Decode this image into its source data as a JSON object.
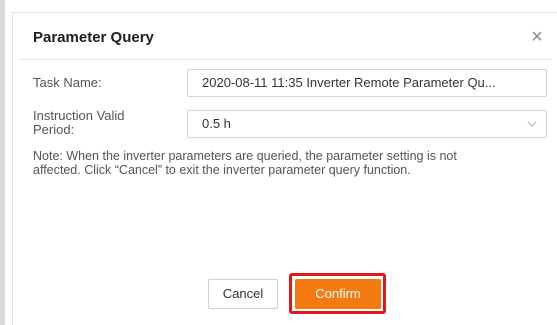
{
  "dialog": {
    "title": "Parameter Query",
    "close_icon": "close-icon",
    "task_name": {
      "label": "Task Name:",
      "value": "2020-08-11 11:35 Inverter Remote Parameter Qu..."
    },
    "valid_period": {
      "label_line1": "Instruction Valid",
      "label_line2": "Period:",
      "value": "0.5 h",
      "icon": "chevron-down-icon"
    },
    "note_line1": "Note: When the inverter parameters are queried, the parameter setting is not",
    "note_line2": "affected. Click “Cancel” to exit the inverter parameter query function.",
    "buttons": {
      "cancel_label": "Cancel",
      "confirm_label": "Confirm"
    }
  },
  "colors": {
    "accent": "#f47b12",
    "highlight": "#e3161b"
  }
}
